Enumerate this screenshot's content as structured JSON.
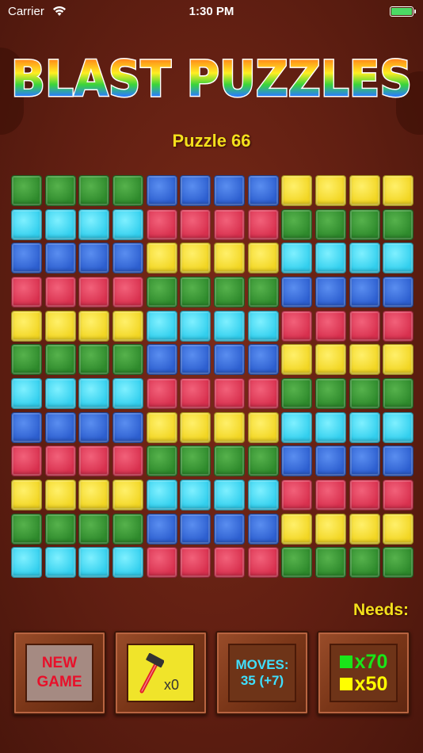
{
  "status": {
    "carrier": "Carrier",
    "time": "1:30 PM"
  },
  "logo": {
    "text": "BLAST PUZZLES"
  },
  "puzzle": {
    "title": "Puzzle 66"
  },
  "colors": {
    "green": "#34a02f",
    "blue": "#3a6fe0",
    "yellow": "#f7dd2a",
    "cyan": "#42d8f5",
    "red": "#e03a57"
  },
  "board": {
    "rows": 12,
    "cols": 12,
    "grid": [
      [
        "green",
        "green",
        "green",
        "green",
        "blue",
        "blue",
        "blue",
        "blue",
        "yellow",
        "yellow",
        "yellow",
        "yellow"
      ],
      [
        "cyan",
        "cyan",
        "cyan",
        "cyan",
        "red",
        "red",
        "red",
        "red",
        "green",
        "green",
        "green",
        "green"
      ],
      [
        "blue",
        "blue",
        "blue",
        "blue",
        "yellow",
        "yellow",
        "yellow",
        "yellow",
        "cyan",
        "cyan",
        "cyan",
        "cyan"
      ],
      [
        "red",
        "red",
        "red",
        "red",
        "green",
        "green",
        "green",
        "green",
        "blue",
        "blue",
        "blue",
        "blue"
      ],
      [
        "yellow",
        "yellow",
        "yellow",
        "yellow",
        "cyan",
        "cyan",
        "cyan",
        "cyan",
        "red",
        "red",
        "red",
        "red"
      ],
      [
        "green",
        "green",
        "green",
        "green",
        "blue",
        "blue",
        "blue",
        "blue",
        "yellow",
        "yellow",
        "yellow",
        "yellow"
      ],
      [
        "cyan",
        "cyan",
        "cyan",
        "cyan",
        "red",
        "red",
        "red",
        "red",
        "green",
        "green",
        "green",
        "green"
      ],
      [
        "blue",
        "blue",
        "blue",
        "blue",
        "yellow",
        "yellow",
        "yellow",
        "yellow",
        "cyan",
        "cyan",
        "cyan",
        "cyan"
      ],
      [
        "red",
        "red",
        "red",
        "red",
        "green",
        "green",
        "green",
        "green",
        "blue",
        "blue",
        "blue",
        "blue"
      ],
      [
        "yellow",
        "yellow",
        "yellow",
        "yellow",
        "cyan",
        "cyan",
        "cyan",
        "cyan",
        "red",
        "red",
        "red",
        "red"
      ],
      [
        "green",
        "green",
        "green",
        "green",
        "blue",
        "blue",
        "blue",
        "blue",
        "yellow",
        "yellow",
        "yellow",
        "yellow"
      ],
      [
        "cyan",
        "cyan",
        "cyan",
        "cyan",
        "red",
        "red",
        "red",
        "red",
        "green",
        "green",
        "green",
        "green"
      ]
    ]
  },
  "needs": {
    "label": "Needs:",
    "items": [
      {
        "color": "green",
        "swatch": "#19e619",
        "text": "x70"
      },
      {
        "color": "yellow",
        "swatch": "#ffff00",
        "text": "x50"
      }
    ]
  },
  "controls": {
    "new_game": "NEW\nGAME",
    "hammer": {
      "icon": "hammer-icon",
      "count": "x0"
    },
    "moves": {
      "label": "MOVES:",
      "value": "35 (+7)"
    }
  }
}
